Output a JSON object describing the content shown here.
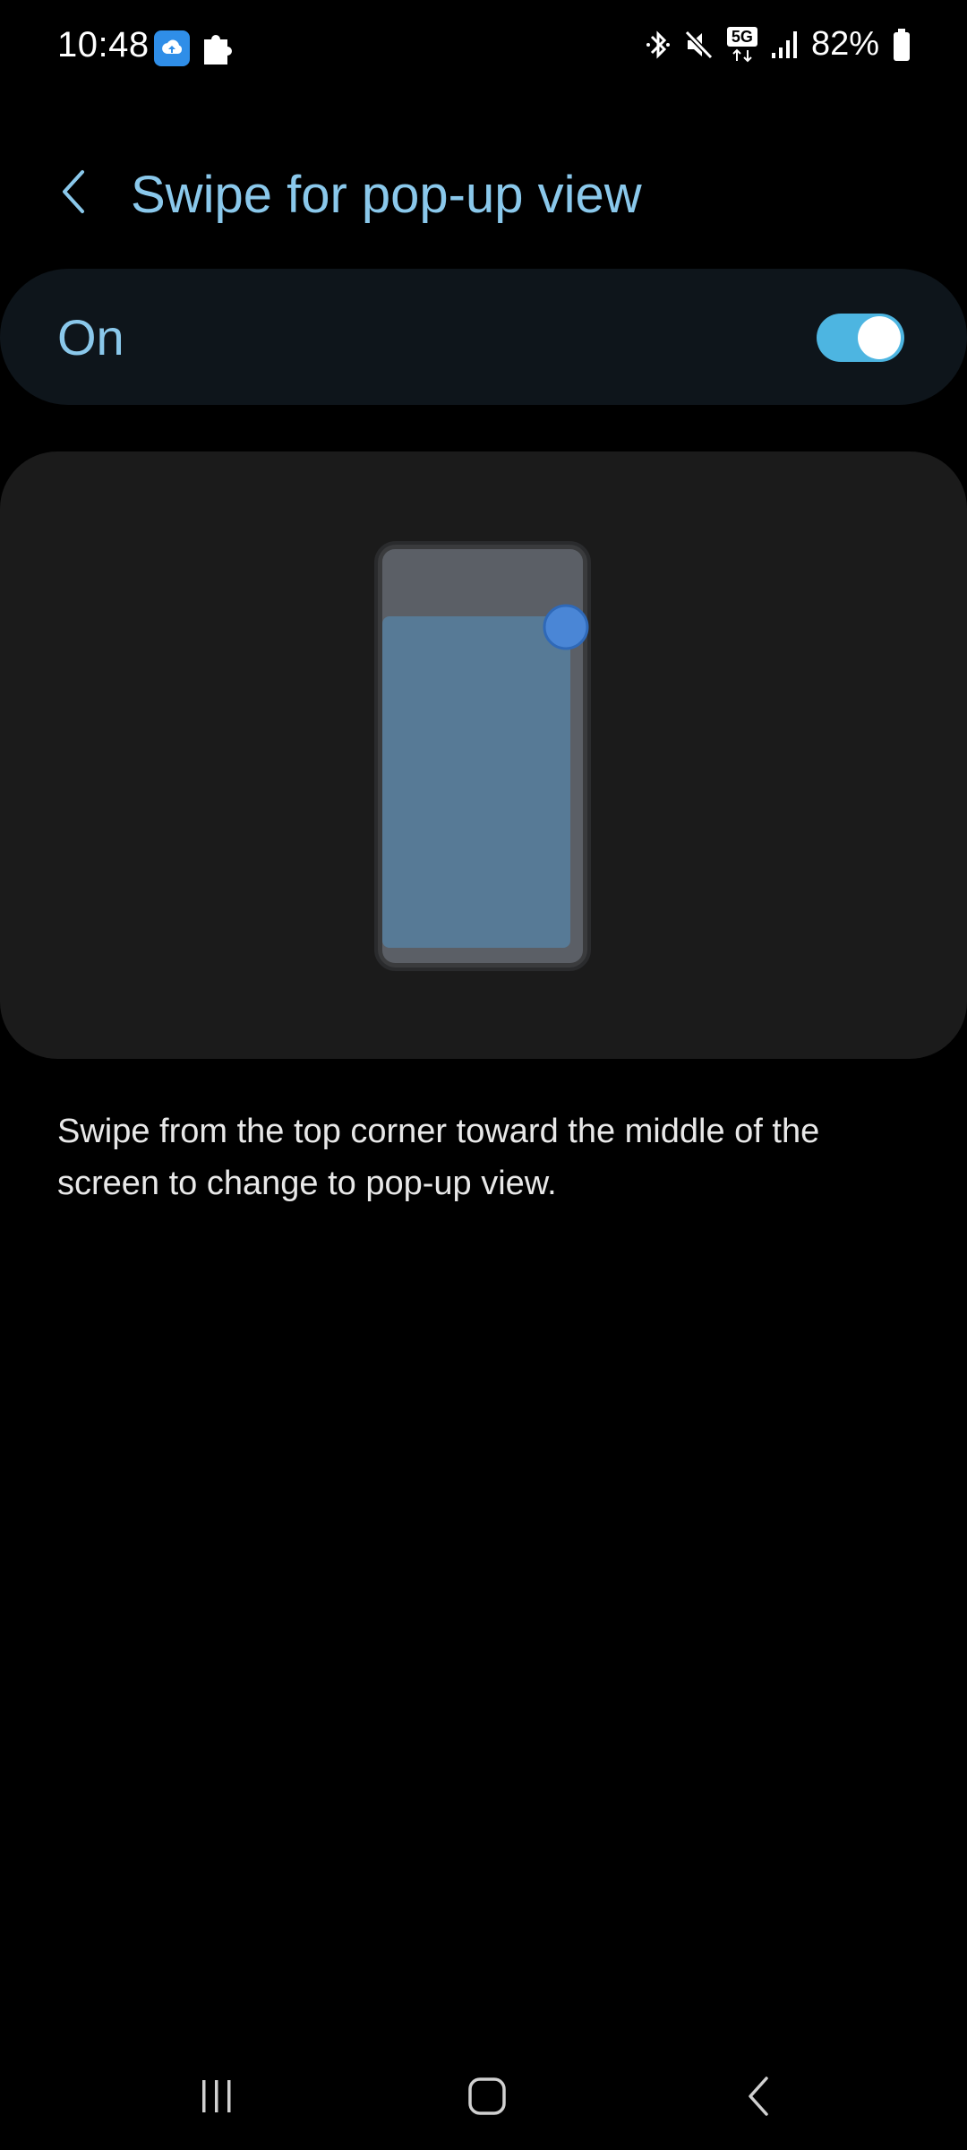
{
  "status_bar": {
    "time": "10:48",
    "left_icons": [
      "cloud-upload-app-icon",
      "puzzle-icon"
    ],
    "right_icons": [
      "bluetooth-icon",
      "mute-icon",
      "5g-icon",
      "signal-icon",
      "battery-icon"
    ],
    "network_label": "5G",
    "battery_percent": "82%",
    "battery_level": 0.82
  },
  "header": {
    "back_icon": "chevron-left-icon",
    "title": "Swipe for pop-up view"
  },
  "toggle": {
    "label": "On",
    "state": true
  },
  "illustration": {
    "name": "phone-swipe-illustration"
  },
  "description": "Swipe from the top corner toward the middle of the screen to change to pop-up view.",
  "nav_bar": {
    "recents_icon": "recents-icon",
    "home_icon": "home-icon",
    "back_icon": "back-icon"
  },
  "colors": {
    "accent": "#8ac8eb",
    "switch_on": "#4db5e1",
    "background": "#000000",
    "card": "#1b1b1b",
    "toggle_card": "#0e151b"
  }
}
